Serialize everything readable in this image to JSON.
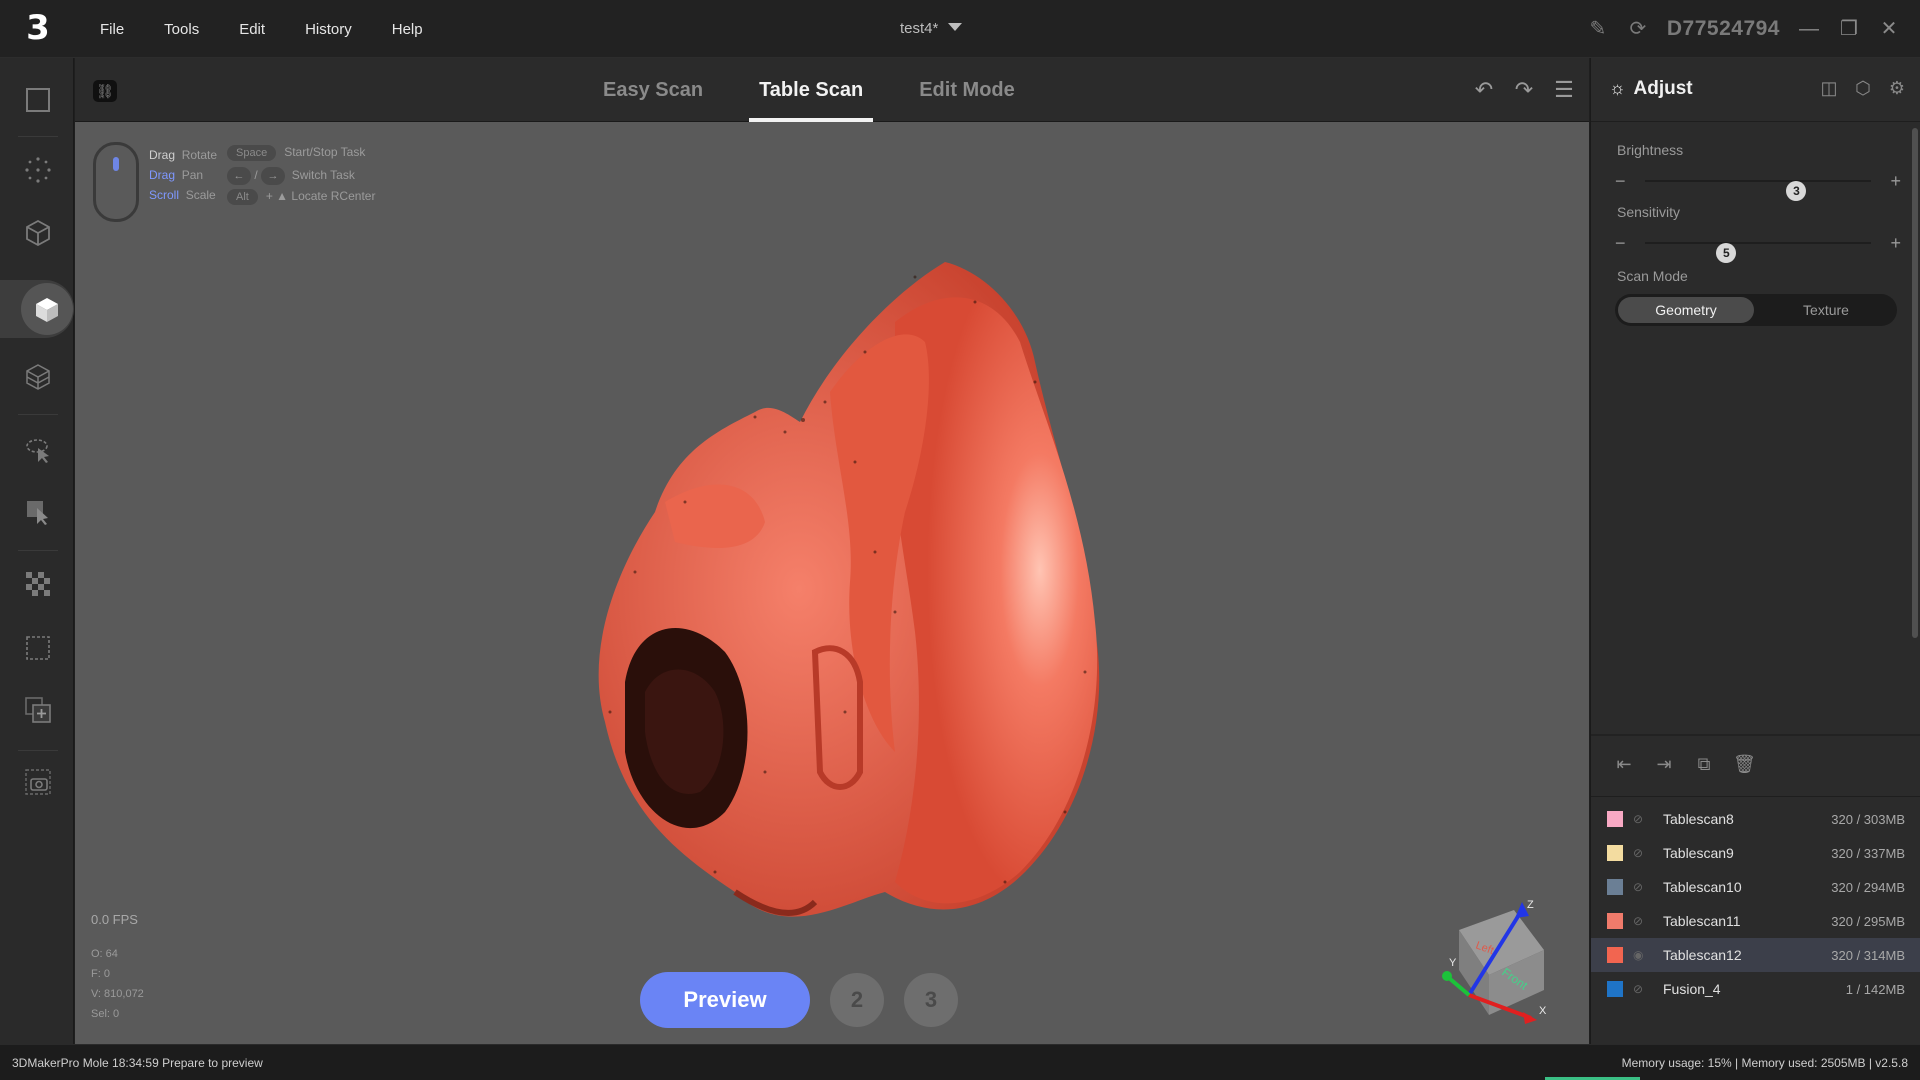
{
  "app": {
    "logo": "3",
    "project_name": "test4*",
    "device_id": "D77524794"
  },
  "menu": [
    "File",
    "Tools",
    "Edit",
    "History",
    "Help"
  ],
  "tabs": {
    "easy_scan": "Easy Scan",
    "table_scan": "Table Scan",
    "edit_mode": "Edit Mode",
    "active": "Table Scan"
  },
  "help": {
    "drag_rotate": [
      "Drag",
      "Rotate"
    ],
    "drag_pan": [
      "Drag",
      "Pan"
    ],
    "scroll_scale": [
      "Scroll",
      "Scale"
    ],
    "space_key": "Space",
    "start_stop": "Start/Stop Task",
    "switch_task": "Switch Task",
    "alt_key": "Alt",
    "locate": "Locate RCenter"
  },
  "viewport_stats": {
    "fps": "0.0 FPS",
    "o": "O: 64",
    "f": "F: 0",
    "v": "V: 810,072",
    "sel": "Sel: 0"
  },
  "controls": {
    "preview_label": "Preview",
    "step2": "2",
    "step3": "3"
  },
  "axis": {
    "z": "Z",
    "y": "Y",
    "x": "X",
    "front": "Front",
    "left": "Left"
  },
  "adjust": {
    "title": "Adjust",
    "brightness_label": "Brightness",
    "brightness_value": "3",
    "brightness_fraction": 0.67,
    "sensitivity_label": "Sensitivity",
    "sensitivity_value": "5",
    "sensitivity_fraction": 0.36,
    "scan_mode_label": "Scan Mode",
    "mode_geometry": "Geometry",
    "mode_texture": "Texture",
    "mode_selected": "Geometry"
  },
  "scans": [
    {
      "name": "Tablescan8",
      "size": "320 / 303MB",
      "color": "#f8a9c4",
      "selected": false
    },
    {
      "name": "Tablescan9",
      "size": "320 / 337MB",
      "color": "#f3dca0",
      "selected": false
    },
    {
      "name": "Tablescan10",
      "size": "320 / 294MB",
      "color": "#6b7f95",
      "selected": false
    },
    {
      "name": "Tablescan11",
      "size": "320 / 295MB",
      "color": "#f07b6b",
      "selected": false
    },
    {
      "name": "Tablescan12",
      "size": "320 / 314MB",
      "color": "#f26550",
      "selected": true
    },
    {
      "name": "Fusion_4",
      "size": "1 / 142MB",
      "color": "#1f74c7",
      "selected": false
    }
  ],
  "status": {
    "left": "3DMakerPro Mole   18:34:59 Prepare to preview",
    "right": "Memory usage: 15% | Memory used: 2505MB | v2.5.8"
  },
  "colors": {
    "accent": "#6a84f5",
    "model": "#f26550",
    "viewport": "#5a5a5a"
  },
  "icons": {
    "left_toolbar": [
      "fit-view-icon",
      "point-select-icon",
      "mesh-cube-icon",
      "solid-cube-icon",
      "wireframe-cube-icon",
      "lasso-select-icon",
      "rect-select-icon",
      "checker-icon",
      "crop-box-icon",
      "add-layer-icon",
      "camera-icon"
    ]
  }
}
